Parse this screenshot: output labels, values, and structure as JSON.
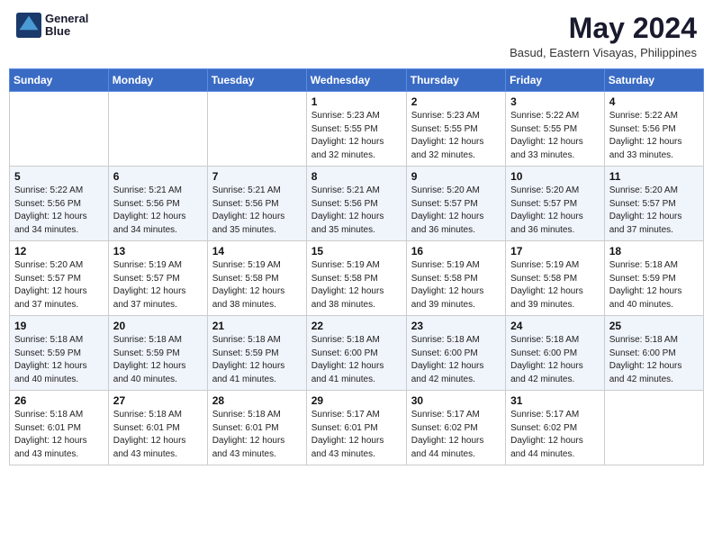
{
  "header": {
    "logo_line1": "General",
    "logo_line2": "Blue",
    "month_title": "May 2024",
    "location": "Basud, Eastern Visayas, Philippines"
  },
  "weekdays": [
    "Sunday",
    "Monday",
    "Tuesday",
    "Wednesday",
    "Thursday",
    "Friday",
    "Saturday"
  ],
  "weeks": [
    [
      {
        "day": "",
        "sunrise": "",
        "sunset": "",
        "daylight": ""
      },
      {
        "day": "",
        "sunrise": "",
        "sunset": "",
        "daylight": ""
      },
      {
        "day": "",
        "sunrise": "",
        "sunset": "",
        "daylight": ""
      },
      {
        "day": "1",
        "sunrise": "Sunrise: 5:23 AM",
        "sunset": "Sunset: 5:55 PM",
        "daylight": "Daylight: 12 hours and 32 minutes."
      },
      {
        "day": "2",
        "sunrise": "Sunrise: 5:23 AM",
        "sunset": "Sunset: 5:55 PM",
        "daylight": "Daylight: 12 hours and 32 minutes."
      },
      {
        "day": "3",
        "sunrise": "Sunrise: 5:22 AM",
        "sunset": "Sunset: 5:55 PM",
        "daylight": "Daylight: 12 hours and 33 minutes."
      },
      {
        "day": "4",
        "sunrise": "Sunrise: 5:22 AM",
        "sunset": "Sunset: 5:56 PM",
        "daylight": "Daylight: 12 hours and 33 minutes."
      }
    ],
    [
      {
        "day": "5",
        "sunrise": "Sunrise: 5:22 AM",
        "sunset": "Sunset: 5:56 PM",
        "daylight": "Daylight: 12 hours and 34 minutes."
      },
      {
        "day": "6",
        "sunrise": "Sunrise: 5:21 AM",
        "sunset": "Sunset: 5:56 PM",
        "daylight": "Daylight: 12 hours and 34 minutes."
      },
      {
        "day": "7",
        "sunrise": "Sunrise: 5:21 AM",
        "sunset": "Sunset: 5:56 PM",
        "daylight": "Daylight: 12 hours and 35 minutes."
      },
      {
        "day": "8",
        "sunrise": "Sunrise: 5:21 AM",
        "sunset": "Sunset: 5:56 PM",
        "daylight": "Daylight: 12 hours and 35 minutes."
      },
      {
        "day": "9",
        "sunrise": "Sunrise: 5:20 AM",
        "sunset": "Sunset: 5:57 PM",
        "daylight": "Daylight: 12 hours and 36 minutes."
      },
      {
        "day": "10",
        "sunrise": "Sunrise: 5:20 AM",
        "sunset": "Sunset: 5:57 PM",
        "daylight": "Daylight: 12 hours and 36 minutes."
      },
      {
        "day": "11",
        "sunrise": "Sunrise: 5:20 AM",
        "sunset": "Sunset: 5:57 PM",
        "daylight": "Daylight: 12 hours and 37 minutes."
      }
    ],
    [
      {
        "day": "12",
        "sunrise": "Sunrise: 5:20 AM",
        "sunset": "Sunset: 5:57 PM",
        "daylight": "Daylight: 12 hours and 37 minutes."
      },
      {
        "day": "13",
        "sunrise": "Sunrise: 5:19 AM",
        "sunset": "Sunset: 5:57 PM",
        "daylight": "Daylight: 12 hours and 37 minutes."
      },
      {
        "day": "14",
        "sunrise": "Sunrise: 5:19 AM",
        "sunset": "Sunset: 5:58 PM",
        "daylight": "Daylight: 12 hours and 38 minutes."
      },
      {
        "day": "15",
        "sunrise": "Sunrise: 5:19 AM",
        "sunset": "Sunset: 5:58 PM",
        "daylight": "Daylight: 12 hours and 38 minutes."
      },
      {
        "day": "16",
        "sunrise": "Sunrise: 5:19 AM",
        "sunset": "Sunset: 5:58 PM",
        "daylight": "Daylight: 12 hours and 39 minutes."
      },
      {
        "day": "17",
        "sunrise": "Sunrise: 5:19 AM",
        "sunset": "Sunset: 5:58 PM",
        "daylight": "Daylight: 12 hours and 39 minutes."
      },
      {
        "day": "18",
        "sunrise": "Sunrise: 5:18 AM",
        "sunset": "Sunset: 5:59 PM",
        "daylight": "Daylight: 12 hours and 40 minutes."
      }
    ],
    [
      {
        "day": "19",
        "sunrise": "Sunrise: 5:18 AM",
        "sunset": "Sunset: 5:59 PM",
        "daylight": "Daylight: 12 hours and 40 minutes."
      },
      {
        "day": "20",
        "sunrise": "Sunrise: 5:18 AM",
        "sunset": "Sunset: 5:59 PM",
        "daylight": "Daylight: 12 hours and 40 minutes."
      },
      {
        "day": "21",
        "sunrise": "Sunrise: 5:18 AM",
        "sunset": "Sunset: 5:59 PM",
        "daylight": "Daylight: 12 hours and 41 minutes."
      },
      {
        "day": "22",
        "sunrise": "Sunrise: 5:18 AM",
        "sunset": "Sunset: 6:00 PM",
        "daylight": "Daylight: 12 hours and 41 minutes."
      },
      {
        "day": "23",
        "sunrise": "Sunrise: 5:18 AM",
        "sunset": "Sunset: 6:00 PM",
        "daylight": "Daylight: 12 hours and 42 minutes."
      },
      {
        "day": "24",
        "sunrise": "Sunrise: 5:18 AM",
        "sunset": "Sunset: 6:00 PM",
        "daylight": "Daylight: 12 hours and 42 minutes."
      },
      {
        "day": "25",
        "sunrise": "Sunrise: 5:18 AM",
        "sunset": "Sunset: 6:00 PM",
        "daylight": "Daylight: 12 hours and 42 minutes."
      }
    ],
    [
      {
        "day": "26",
        "sunrise": "Sunrise: 5:18 AM",
        "sunset": "Sunset: 6:01 PM",
        "daylight": "Daylight: 12 hours and 43 minutes."
      },
      {
        "day": "27",
        "sunrise": "Sunrise: 5:18 AM",
        "sunset": "Sunset: 6:01 PM",
        "daylight": "Daylight: 12 hours and 43 minutes."
      },
      {
        "day": "28",
        "sunrise": "Sunrise: 5:18 AM",
        "sunset": "Sunset: 6:01 PM",
        "daylight": "Daylight: 12 hours and 43 minutes."
      },
      {
        "day": "29",
        "sunrise": "Sunrise: 5:17 AM",
        "sunset": "Sunset: 6:01 PM",
        "daylight": "Daylight: 12 hours and 43 minutes."
      },
      {
        "day": "30",
        "sunrise": "Sunrise: 5:17 AM",
        "sunset": "Sunset: 6:02 PM",
        "daylight": "Daylight: 12 hours and 44 minutes."
      },
      {
        "day": "31",
        "sunrise": "Sunrise: 5:17 AM",
        "sunset": "Sunset: 6:02 PM",
        "daylight": "Daylight: 12 hours and 44 minutes."
      },
      {
        "day": "",
        "sunrise": "",
        "sunset": "",
        "daylight": ""
      }
    ]
  ]
}
